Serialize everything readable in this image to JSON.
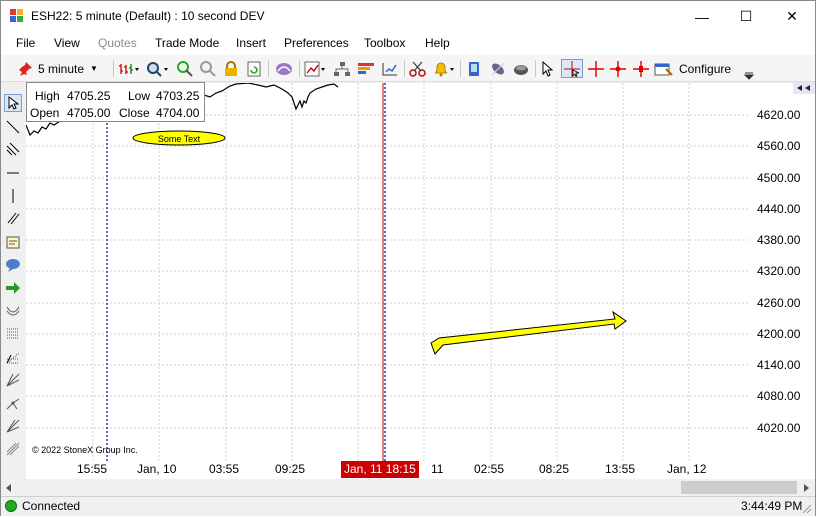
{
  "window": {
    "title": "ESH22: 5 minute (Default) : 10 second DEV",
    "minimize": "—",
    "maximize": "☐",
    "close": "✕"
  },
  "menu": [
    "File",
    "View",
    "Quotes",
    "Trade Mode",
    "Insert",
    "Preferences",
    "Toolbox",
    "Help"
  ],
  "toolbar": {
    "interval": "5 minute",
    "configure": "Configure"
  },
  "ohlc": {
    "high_label": "High",
    "high": "4705.25",
    "low_label": "Low",
    "low": "4703.25",
    "open_label": "Open",
    "open": "4705.00",
    "close_label": "Close",
    "close": "4704.00"
  },
  "annotation": {
    "text": "Some Text"
  },
  "copyright": "© 2022 StoneX Group Inc.",
  "yaxis": [
    "4620.00",
    "4560.00",
    "4500.00",
    "4440.00",
    "4380.00",
    "4320.00",
    "4260.00",
    "4200.00",
    "4140.00",
    "4080.00",
    "4020.00"
  ],
  "xaxis": [
    "15:55",
    "Jan, 10",
    "03:55",
    "09:25",
    "11",
    "02:55",
    "08:25",
    "13:55",
    "Jan, 12"
  ],
  "xaxis_highlight": "Jan, 11 18:15",
  "status": {
    "connection": "Connected",
    "time": "3:44:49 PM"
  },
  "colors": {
    "arrow_fill": "#ffff00",
    "highlight": "#cc0000",
    "vline": "#00007f",
    "connected": "#22aa22"
  }
}
